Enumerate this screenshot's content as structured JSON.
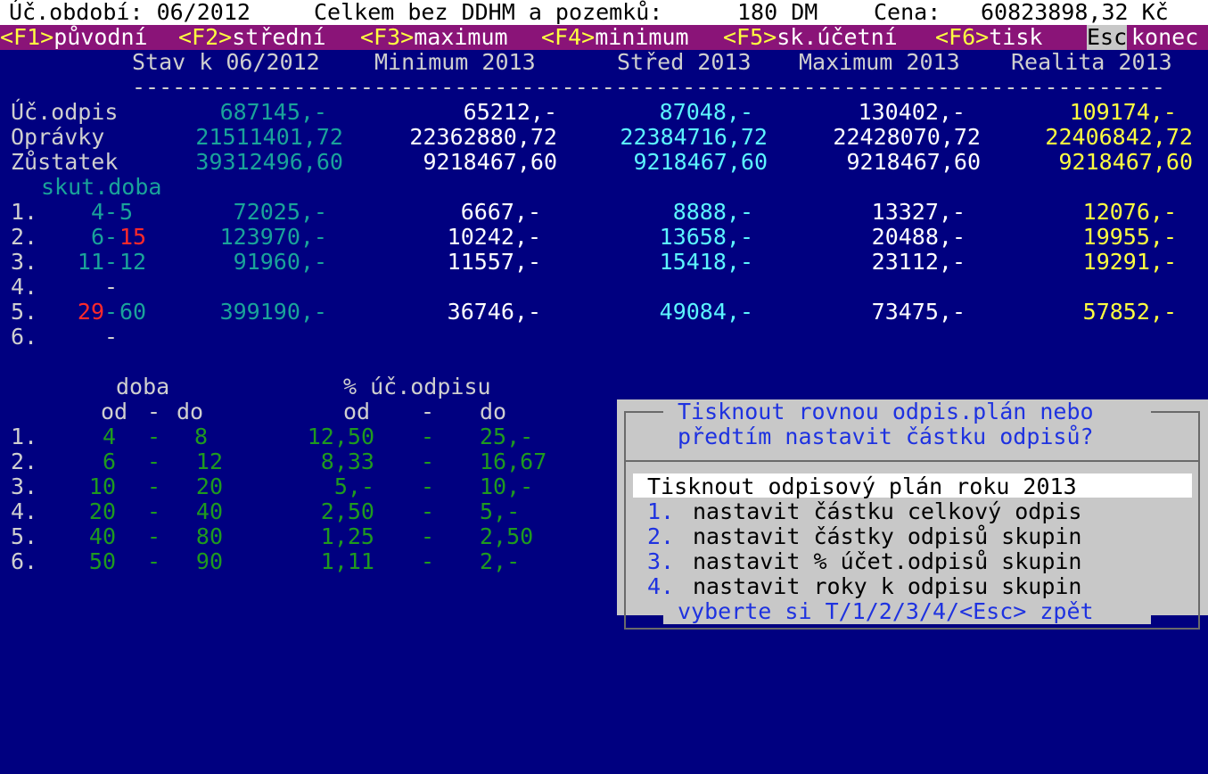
{
  "status": {
    "period": "Úč.období: 06/2012",
    "total_label": "Celkem bez DDHM a pozemků:",
    "total_value": "180 DM",
    "price_label": "Cena:",
    "price_value": "60823898,32 Kč"
  },
  "fkeys": [
    {
      "key": "<F1>",
      "label": "původní"
    },
    {
      "key": "<F2>",
      "label": "střední"
    },
    {
      "key": "<F3>",
      "label": "maximum"
    },
    {
      "key": "<F4>",
      "label": "minimum"
    },
    {
      "key": "<F5>",
      "label": "sk.účetní"
    },
    {
      "key": "<F6>",
      "label": "tisk"
    },
    {
      "key": "Esc",
      "label": "konec"
    }
  ],
  "table": {
    "headers": [
      "Stav k 06/2012",
      "Minimum 2013",
      "Střed 2013",
      "Maximum 2013",
      "Realita 2013"
    ],
    "separator": "-----------------------------------------------------------------------------",
    "summary": [
      {
        "label": "Úč.odpis",
        "values": [
          "687145,-",
          "65212,-",
          "87048,-",
          "130402,-",
          "109174,-"
        ]
      },
      {
        "label": "Oprávky",
        "values": [
          "21511401,72",
          "22362880,72",
          "22384716,72",
          "22428070,72",
          "22406842,72"
        ]
      },
      {
        "label": "Zůstatek",
        "values": [
          "39312496,60",
          "9218467,60",
          "9218467,60",
          "9218467,60",
          "9218467,60"
        ]
      }
    ],
    "groups_title": "skut.doba",
    "groups": [
      {
        "num": "1.",
        "from": "4",
        "to": "5",
        "values": [
          "72025,-",
          "6667,-",
          "8888,-",
          "13327,-",
          "12076,-"
        ]
      },
      {
        "num": "2.",
        "from": "6",
        "to": "15",
        "values": [
          "123970,-",
          "10242,-",
          "13658,-",
          "20488,-",
          "19955,-"
        ]
      },
      {
        "num": "3.",
        "from": "11",
        "to": "12",
        "values": [
          "91960,-",
          "11557,-",
          "15418,-",
          "23112,-",
          "19291,-"
        ]
      },
      {
        "num": "4.",
        "from": "",
        "to": "",
        "values": [
          "",
          "",
          "",
          "",
          ""
        ]
      },
      {
        "num": "5.",
        "from": "29",
        "to": "60",
        "values": [
          "399190,-",
          "36746,-",
          "49084,-",
          "73475,-",
          "57852,-"
        ]
      },
      {
        "num": "6.",
        "from": "",
        "to": "",
        "values": [
          "",
          "",
          "",
          "",
          ""
        ]
      }
    ]
  },
  "rates": {
    "title_period": "doba",
    "title_percent": "% úč.odpisu",
    "from_label": "od",
    "to_label": "do",
    "dash": "-",
    "rows": [
      {
        "num": "1.",
        "p_from": "4",
        "p_to": "8",
        "r_from": "12,50",
        "r_to": "25,-"
      },
      {
        "num": "2.",
        "p_from": "6",
        "p_to": "12",
        "r_from": "8,33",
        "r_to": "16,67"
      },
      {
        "num": "3.",
        "p_from": "10",
        "p_to": "20",
        "r_from": "5,-",
        "r_to": "10,-"
      },
      {
        "num": "4.",
        "p_from": "20",
        "p_to": "40",
        "r_from": "2,50",
        "r_to": "5,-"
      },
      {
        "num": "5.",
        "p_from": "40",
        "p_to": "80",
        "r_from": "1,25",
        "r_to": "2,50"
      },
      {
        "num": "6.",
        "p_from": "50",
        "p_to": "90",
        "r_from": "1,11",
        "r_to": "2,-"
      }
    ]
  },
  "dialog": {
    "question_line1": "Tisknout rovnou odpis.plán nebo",
    "question_line2": "předtím nastavit částku odpisů?",
    "options": [
      {
        "num": "",
        "label": "Tisknout odpisový plán roku 2013"
      },
      {
        "num": "1.",
        "label": "nastavit částku celkový odpis"
      },
      {
        "num": "2.",
        "label": "nastavit částky odpisů skupin"
      },
      {
        "num": "3.",
        "label": "nastavit % účet.odpisů skupin"
      },
      {
        "num": "4.",
        "label": "nastavit roky k odpisu skupin"
      }
    ],
    "footer": "vyberte si T/1/2/3/4/<Esc> zpět"
  },
  "colors": {
    "background": "#000080",
    "fkey_bar": "#8a1478",
    "minimum": "#ffffff",
    "stred": "#5cf5ff",
    "maximum": "#ffffff",
    "realita": "#ffff40",
    "stav": "#1aa39a",
    "rates": "#1f9a1f",
    "highlight_digits": "#ff2a2a",
    "dialog_bg": "#c8c8c8",
    "dialog_text": "#1e32e0"
  }
}
